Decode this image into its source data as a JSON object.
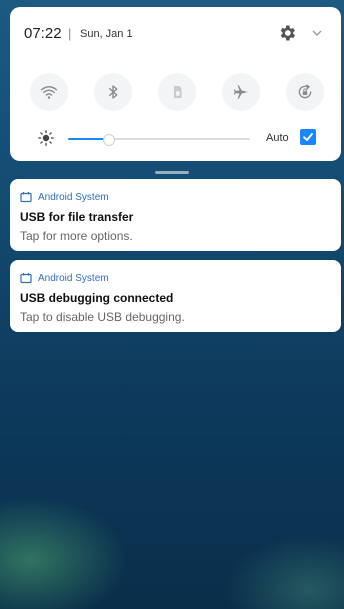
{
  "status": {
    "time": "07:22",
    "separator": "|",
    "date": "Sun, Jan 1"
  },
  "quick_settings": {
    "tiles": [
      {
        "icon": "wifi-icon",
        "state": "off"
      },
      {
        "icon": "bluetooth-icon",
        "state": "off"
      },
      {
        "icon": "sim-card-icon",
        "state": "off"
      },
      {
        "icon": "airplane-icon",
        "state": "off"
      },
      {
        "icon": "rotation-lock-icon",
        "state": "off"
      }
    ],
    "brightness": {
      "level": 0.22,
      "auto_label": "Auto",
      "auto_checked": true
    }
  },
  "notifications": [
    {
      "app": "Android System",
      "title": "USB for file transfer",
      "text": "Tap for more options."
    },
    {
      "app": "Android System",
      "title": "USB debugging connected",
      "text": "Tap to disable USB debugging."
    }
  ],
  "colors": {
    "accent": "#1a86ff",
    "app_label": "#2f6fb2",
    "wallpaper": "#134a70"
  }
}
